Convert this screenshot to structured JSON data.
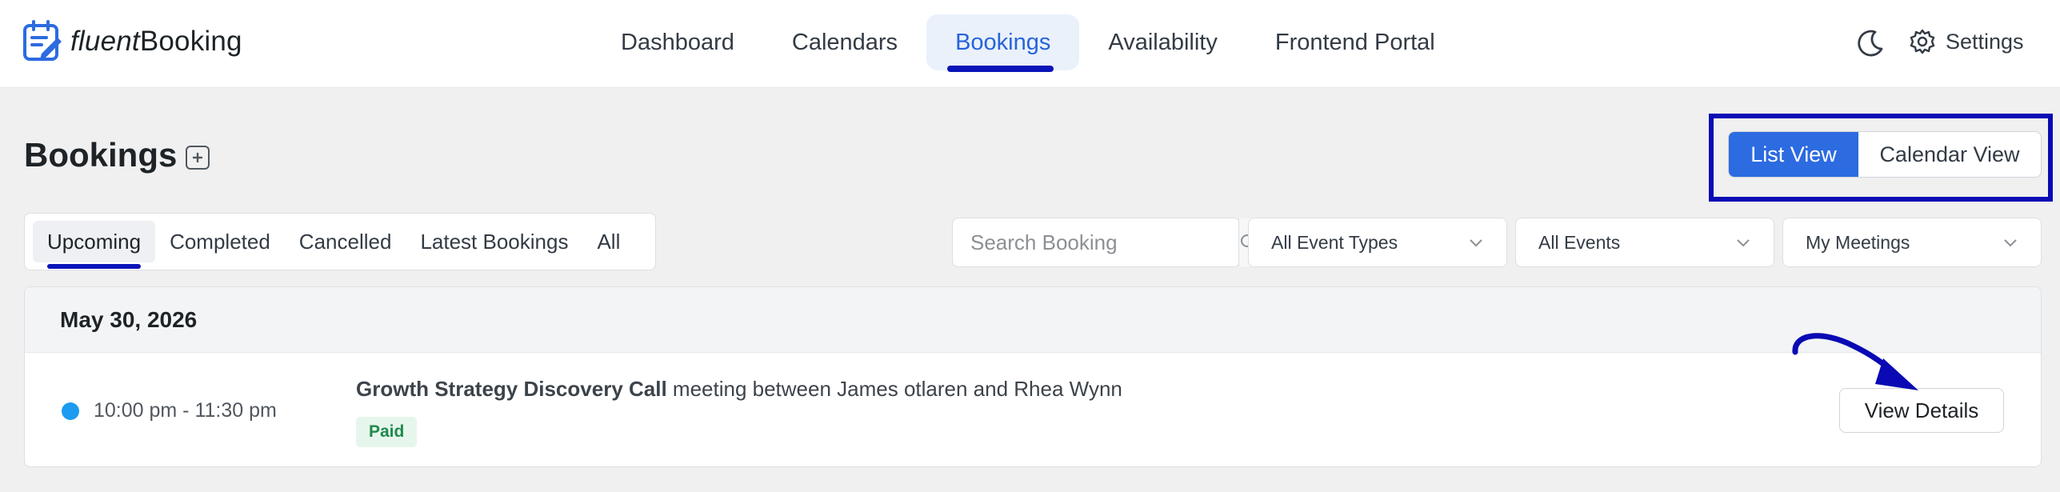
{
  "app": {
    "logo_part1": "fluent",
    "logo_part2": "Booking",
    "logo_icon": "calendar-pen-icon"
  },
  "nav": {
    "items": [
      {
        "label": "Dashboard",
        "active": false
      },
      {
        "label": "Calendars",
        "active": false
      },
      {
        "label": "Bookings",
        "active": true
      },
      {
        "label": "Availability",
        "active": false
      },
      {
        "label": "Frontend Portal",
        "active": false
      }
    ],
    "theme_icon": "moon-icon",
    "settings_icon": "gear-icon",
    "settings_label": "Settings"
  },
  "page": {
    "title": "Bookings",
    "add_icon": "plus-square-icon"
  },
  "view_switch": {
    "list_label": "List View",
    "calendar_label": "Calendar View",
    "selected": "List View"
  },
  "tabs": [
    {
      "label": "Upcoming",
      "active": true
    },
    {
      "label": "Completed",
      "active": false
    },
    {
      "label": "Cancelled",
      "active": false
    },
    {
      "label": "Latest Bookings",
      "active": false
    },
    {
      "label": "All",
      "active": false
    }
  ],
  "filters": {
    "search_placeholder": "Search Booking",
    "search_value": "",
    "search_icon": "search-icon",
    "event_types": "All Event Types",
    "events": "All Events",
    "meetings": "My Meetings"
  },
  "bookings": {
    "date": "May 30, 2026",
    "items": [
      {
        "time": "10:00 pm - 11:30 pm",
        "event_name": "Growth Strategy Discovery Call",
        "description": " meeting between James otlaren and Rhea Wynn",
        "payment_status": "Paid",
        "action_label": "View Details"
      }
    ]
  },
  "colors": {
    "accent": "#2c6be0",
    "annotation": "#0a0ab4",
    "status_dot": "#1d9bf0",
    "paid_bg": "#e6f6ec",
    "paid_text": "#1f8a4c"
  }
}
